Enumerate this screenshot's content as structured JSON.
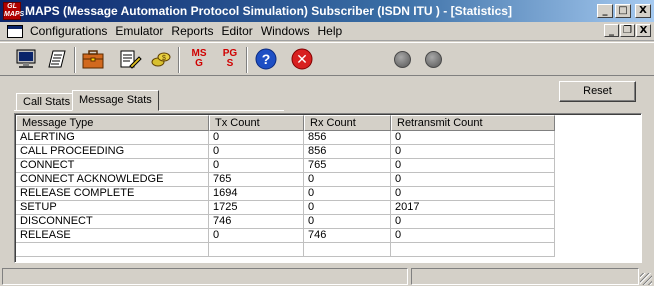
{
  "window": {
    "title": "MAPS (Message Automation Protocol Simulation) Subscriber (ISDN ITU ) - [Statistics]",
    "app_icon_text": "GL MAPS",
    "min_glyph": "_",
    "max_glyph": "□",
    "close_glyph": "X",
    "restore_glyph": "❐"
  },
  "menu": {
    "items": [
      {
        "label": "Configurations"
      },
      {
        "label": "Emulator"
      },
      {
        "label": "Reports"
      },
      {
        "label": "Editor"
      },
      {
        "label": "Windows"
      },
      {
        "label": "Help"
      }
    ]
  },
  "toolbar": {
    "buttons": [
      "monitor-icon",
      "notebook-icon",
      "briefcase-icon",
      "script-edit-icon",
      "coins-icon",
      "msg-g-icon",
      "pg-s-icon",
      "help-icon",
      "stop-icon"
    ],
    "msg_g_top": "MS",
    "msg_g_bottom": "G",
    "pg_s_top": "PG",
    "pg_s_bottom": "S",
    "help_glyph": "?",
    "stop_glyph": "✕",
    "leds": [
      "status-led-1",
      "status-led-2"
    ]
  },
  "tabs": [
    {
      "label": "Call Stats",
      "active": false
    },
    {
      "label": "Message Stats",
      "active": true
    }
  ],
  "reset_label": "Reset",
  "table": {
    "columns": [
      "Message Type",
      "Tx Count",
      "Rx Count",
      "Retransmit Count"
    ],
    "rows": [
      [
        "ALERTING",
        "0",
        "856",
        "0"
      ],
      [
        "CALL PROCEEDING",
        "0",
        "856",
        "0"
      ],
      [
        "CONNECT",
        "0",
        "765",
        "0"
      ],
      [
        "CONNECT ACKNOWLEDGE",
        "765",
        "0",
        "0"
      ],
      [
        "RELEASE COMPLETE",
        "1694",
        "0",
        "0"
      ],
      [
        "SETUP",
        "1725",
        "0",
        "2017"
      ],
      [
        "DISCONNECT",
        "746",
        "0",
        "0"
      ],
      [
        "RELEASE",
        "0",
        "746",
        "0"
      ],
      [
        "",
        "",
        "",
        ""
      ]
    ]
  },
  "colors": {
    "titlebar_start": "#0a246a",
    "titlebar_end": "#a6caf0",
    "face": "#d4d0c8"
  }
}
